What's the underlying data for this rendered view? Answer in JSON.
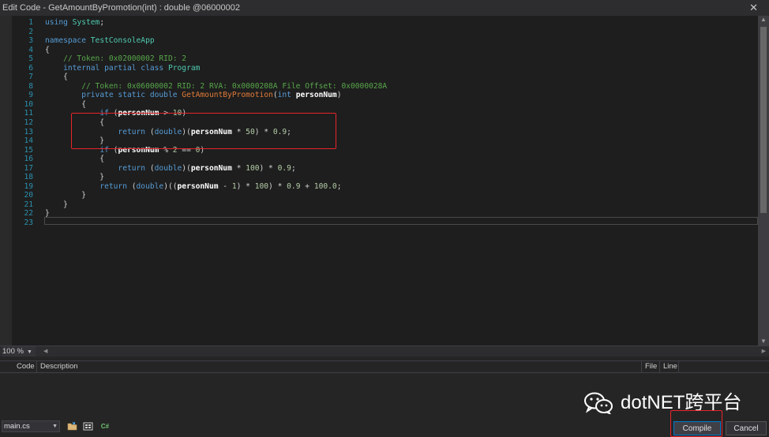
{
  "window": {
    "title": "Edit Code - GetAmountByPromotion(int) : double @06000002",
    "close_glyph": "✕"
  },
  "editor": {
    "lines": [
      {
        "num": "1",
        "html": "<span class=\"kw\">using</span> <span class=\"ty\">System</span>;"
      },
      {
        "num": "2",
        "html": ""
      },
      {
        "num": "3",
        "html": "<span class=\"kw\">namespace</span> <span class=\"ty\">TestConsoleApp</span>"
      },
      {
        "num": "4",
        "html": "{"
      },
      {
        "num": "5",
        "html": "    <span class=\"cm\">// Token: 0x02000002 RID: 2</span>"
      },
      {
        "num": "6",
        "html": "    <span class=\"kw\">internal partial class</span> <span class=\"ty\">Program</span>"
      },
      {
        "num": "7",
        "html": "    {"
      },
      {
        "num": "8",
        "html": "        <span class=\"cm\">// Token: 0x06000002 RID: 2 RVA: 0x0000208A File Offset: 0x0000028A</span>"
      },
      {
        "num": "9",
        "html": "        <span class=\"kw\">private static double</span> <span class=\"mt\">GetAmountByPromotion</span>(<span class=\"kw\">int</span> <span class=\"pm\">personNum</span>)"
      },
      {
        "num": "10",
        "html": "        {"
      },
      {
        "num": "11",
        "html": "            <span class=\"kw\">if</span> (<span class=\"pm\">personNum</span> &gt; <span class=\"nm\">10</span>)"
      },
      {
        "num": "12",
        "html": "            {"
      },
      {
        "num": "13",
        "html": "                <span class=\"kw\">return</span> (<span class=\"kw\">double</span>)(<span class=\"pm\">personNum</span> * <span class=\"nm\">50</span>) * <span class=\"nm\">0.9</span>;"
      },
      {
        "num": "14",
        "html": "            }"
      },
      {
        "num": "15",
        "html": "            <span class=\"kw\">if</span> (<span class=\"pm\">personNum</span> % <span class=\"nm\">2</span> == <span class=\"nm\">0</span>)"
      },
      {
        "num": "16",
        "html": "            {"
      },
      {
        "num": "17",
        "html": "                <span class=\"kw\">return</span> (<span class=\"kw\">double</span>)(<span class=\"pm\">personNum</span> * <span class=\"nm\">100</span>) * <span class=\"nm\">0.9</span>;"
      },
      {
        "num": "18",
        "html": "            }"
      },
      {
        "num": "19",
        "html": "            <span class=\"kw\">return</span> (<span class=\"kw\">double</span>)((<span class=\"pm\">personNum</span> - <span class=\"nm\">1</span>) * <span class=\"nm\">100</span>) * <span class=\"nm\">0.9</span> + <span class=\"nm\">100.0</span>;"
      },
      {
        "num": "20",
        "html": "        }"
      },
      {
        "num": "21",
        "html": "    }"
      },
      {
        "num": "22",
        "html": "}"
      },
      {
        "num": "23",
        "html": ""
      }
    ]
  },
  "zoom": {
    "value": "100 %"
  },
  "errors_panel": {
    "columns": {
      "code": "Code",
      "description": "Description",
      "file": "File",
      "line": "Line"
    }
  },
  "watermark": {
    "text": "dotNET跨平台"
  },
  "bottom": {
    "file": "main.cs",
    "compile_label": "Compile",
    "cancel_label": "Cancel",
    "toolbar_c_label": "C#"
  },
  "colors": {
    "highlight": "#e8242a",
    "accent": "#007acc"
  }
}
